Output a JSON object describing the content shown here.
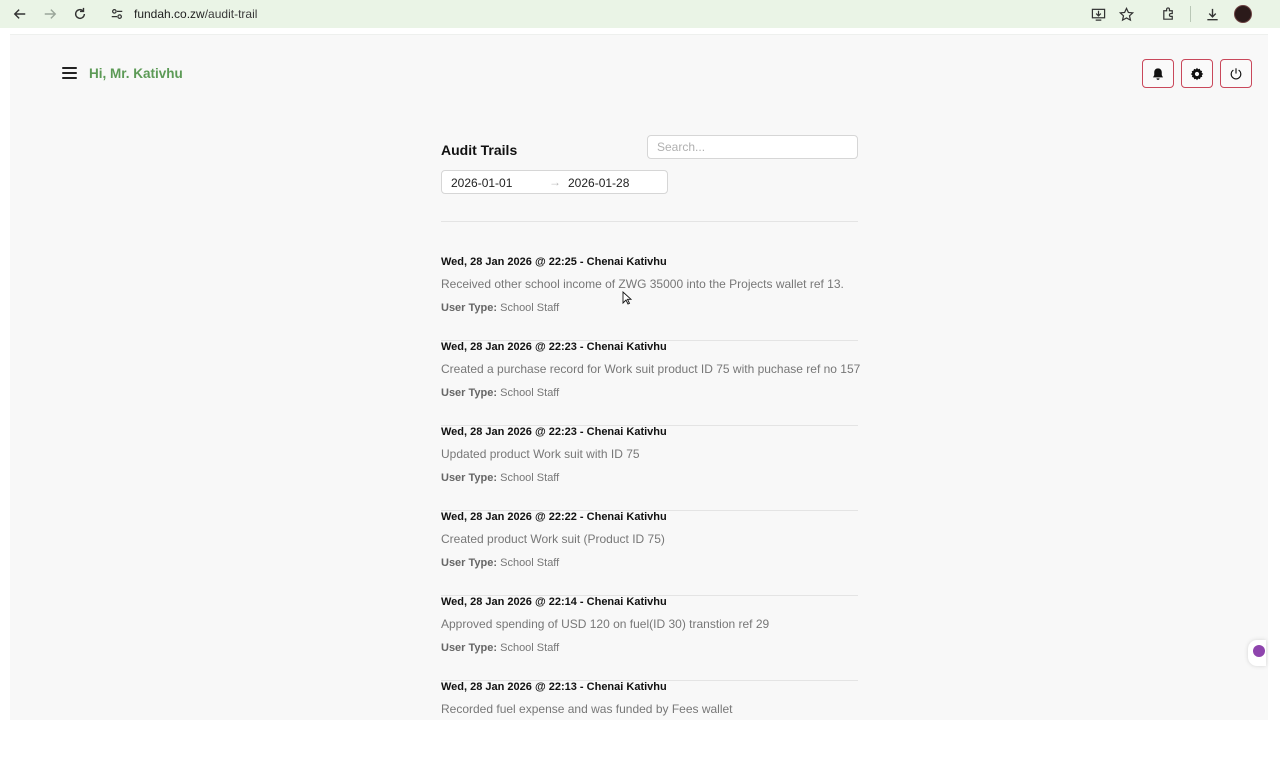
{
  "browser": {
    "url_domain": "fundah.co.zw",
    "url_path": "/audit-trail"
  },
  "header": {
    "greeting": "Hi, Mr. Kativhu",
    "icons": [
      "bell-icon",
      "gear-icon",
      "power-icon"
    ]
  },
  "audit": {
    "title": "Audit Trails",
    "search_placeholder": "Search...",
    "date_from": "2026-01-01",
    "date_arrow": "→",
    "date_to": "2026-01-28",
    "user_type_label": "User Type:",
    "entries": [
      {
        "heading": "Wed, 28 Jan 2026 @ 22:25 - Chenai Kativhu",
        "description": "Received other school income of ZWG 35000 into the Projects wallet ref 13.",
        "user_type": "School Staff"
      },
      {
        "heading": "Wed, 28 Jan 2026 @ 22:23 - Chenai Kativhu",
        "description": "Created a purchase record for Work suit product ID 75 with puchase ref no 157",
        "user_type": "School Staff"
      },
      {
        "heading": "Wed, 28 Jan 2026 @ 22:23 - Chenai Kativhu",
        "description": "Updated product Work suit with ID 75",
        "user_type": "School Staff"
      },
      {
        "heading": "Wed, 28 Jan 2026 @ 22:22 - Chenai Kativhu",
        "description": "Created product Work suit (Product ID 75)",
        "user_type": "School Staff"
      },
      {
        "heading": "Wed, 28 Jan 2026 @ 22:14 - Chenai Kativhu",
        "description": "Approved spending of USD 120 on fuel(ID 30) transtion ref 29",
        "user_type": "School Staff"
      },
      {
        "heading": "Wed, 28 Jan 2026 @ 22:13 - Chenai Kativhu",
        "description": "Recorded fuel expense and was funded by Fees wallet",
        "user_type": ""
      }
    ]
  },
  "colors": {
    "accent_green": "#5c9a56",
    "button_border": "#c9485b",
    "browser_bar": "#eaf4e6"
  }
}
